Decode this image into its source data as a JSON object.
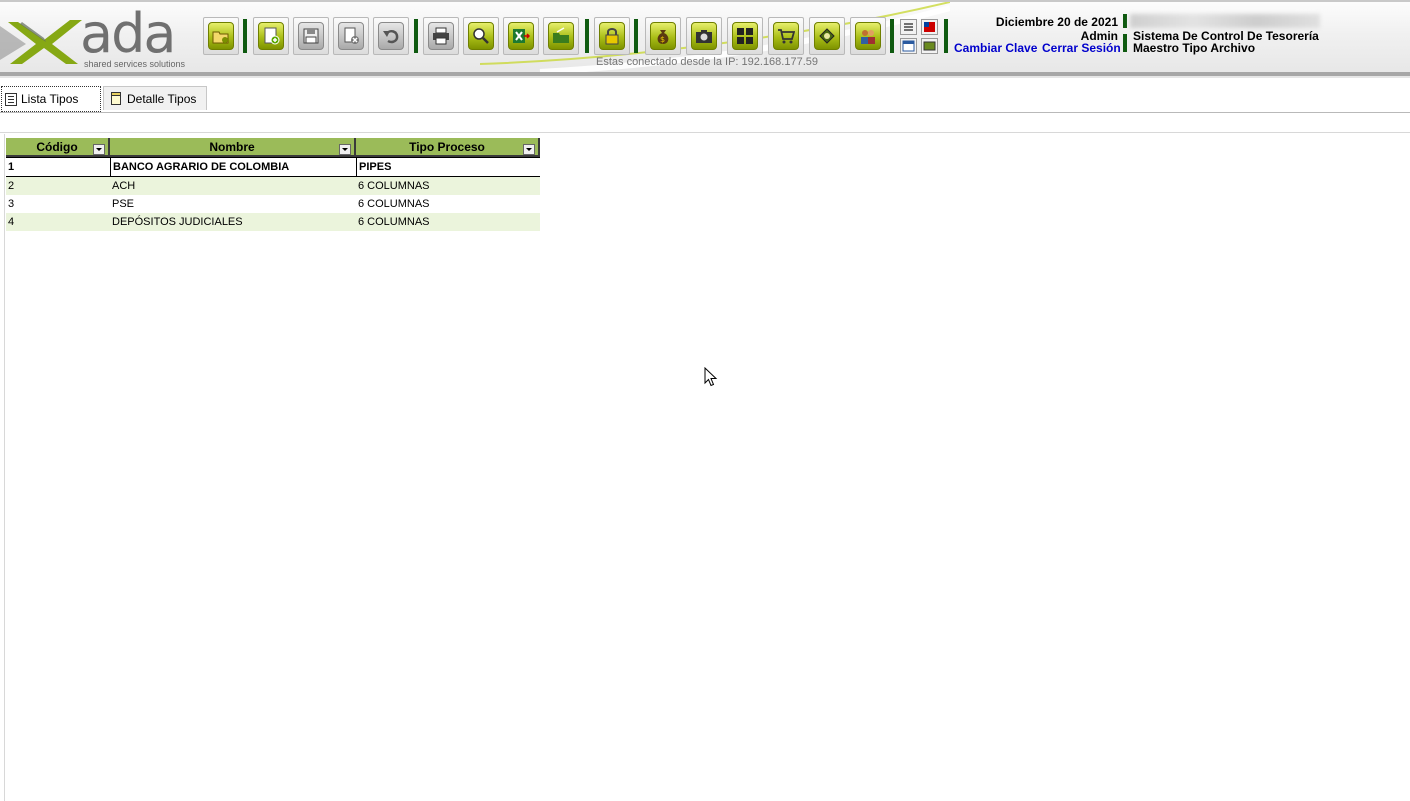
{
  "header": {
    "logo_text": "ada",
    "logo_tagline": "shared services solutions",
    "ip_text": "Estas conectado desde la IP: 192.168.177.59",
    "date": "Diciembre 20 de 2021",
    "user": "Admin",
    "change_password": "Cambiar Clave",
    "logout": "Cerrar Sesión",
    "system_name": "Sistema De Control De Tesorería",
    "module_name": "Maestro Tipo Archivo",
    "brand_color": "#9bbb59"
  },
  "toolbar": {
    "icons": [
      "open-folder-icon",
      "new-document-icon",
      "save-icon",
      "delete-icon",
      "undo-icon",
      "print-icon",
      "search-icon",
      "export-excel-icon",
      "open-icon",
      "lock-icon",
      "money-bag-icon",
      "camera-icon",
      "grid-icon",
      "cart-icon",
      "settings-icon",
      "users-icon"
    ],
    "small_icons": [
      "list-icon",
      "flag-icon",
      "window-icon",
      "image-icon"
    ]
  },
  "tabs": [
    {
      "label": "Lista Tipos",
      "active": true
    },
    {
      "label": "Detalle Tipos",
      "active": false
    }
  ],
  "grid": {
    "columns": [
      "Código",
      "Nombre",
      "Tipo Proceso"
    ],
    "rows": [
      {
        "codigo": "1",
        "nombre": "BANCO AGRARIO DE COLOMBIA",
        "tipo": "PIPES"
      },
      {
        "codigo": "2",
        "nombre": "ACH",
        "tipo": "6 COLUMNAS"
      },
      {
        "codigo": "3",
        "nombre": "PSE",
        "tipo": "6 COLUMNAS"
      },
      {
        "codigo": "4",
        "nombre": "DEPÓSITOS JUDICIALES",
        "tipo": "6 COLUMNAS"
      }
    ]
  }
}
